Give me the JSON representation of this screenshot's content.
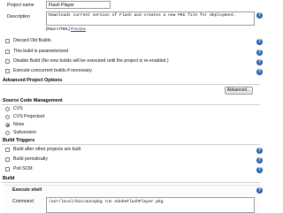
{
  "project": {
    "name_label": "Project name",
    "name_value": "Flash Player",
    "description_label": "Description",
    "description_value": "Downloads current version of Flash and creates a new PKG file for deployment.",
    "raw_html_label": "[Raw HTML]",
    "preview_label": "Preview"
  },
  "options": [
    "Discard Old Builds",
    "This build is parameterized",
    "Disable Build (No new builds will be executed until the project is re-enabled.)",
    "Execute concurrent builds if necessary"
  ],
  "advanced_section": {
    "title": "Advanced Project Options",
    "button_label": "Advanced..."
  },
  "scm_section": {
    "title": "Source Code Management",
    "options": [
      "CVS",
      "CVS Projectset",
      "None",
      "Subversion"
    ],
    "selected": "None"
  },
  "triggers_section": {
    "title": "Build Triggers",
    "options": [
      "Build after other projects are built",
      "Build periodically",
      "Poll SCM"
    ]
  },
  "build_section": {
    "title": "Build",
    "step_title": "Execute shell",
    "command_label": "Command",
    "command_value": "/usr/local/bin/autopkg run AdobeFlashPlayer.pkg"
  },
  "colors": {
    "help_icon": "#3a74c4",
    "link": "#204a87"
  },
  "icons": {
    "help": "help-icon",
    "question_mark": "?"
  }
}
